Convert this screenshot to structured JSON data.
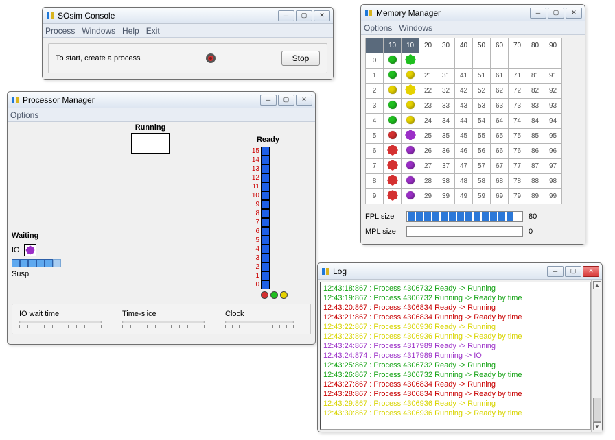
{
  "console": {
    "title": "SOsim Console",
    "menu": [
      "Process",
      "Windows",
      "Help",
      "Exit"
    ],
    "hint": "To start, create a process",
    "stop_label": "Stop"
  },
  "processor": {
    "title": "Processor Manager",
    "menu": [
      "Options"
    ],
    "running_label": "Running",
    "ready_label": "Ready",
    "ready_levels": [
      "15",
      "14",
      "13",
      "12",
      "11",
      "10",
      "9",
      "8",
      "7",
      "6",
      "5",
      "4",
      "3",
      "2",
      "1",
      "0"
    ],
    "waiting_label": "Waiting",
    "io_label": "IO",
    "susp_label": "Susp",
    "io_wait_label": "IO wait time",
    "timeslice_label": "Time-slice",
    "clock_label": "Clock"
  },
  "memory": {
    "title": "Memory Manager",
    "menu": [
      "Options",
      "Windows"
    ],
    "headers": [
      "",
      "10",
      "10",
      "20",
      "30",
      "40",
      "50",
      "60",
      "70",
      "80",
      "90"
    ],
    "rows": [
      {
        "label": "0",
        "dots": [
          {
            "type": "dot",
            "color": "#1fbf1f"
          },
          {
            "type": "burst",
            "cls": "burst-green"
          }
        ]
      },
      {
        "label": "1",
        "dots": [
          {
            "type": "dot",
            "color": "#1fbf1f"
          },
          {
            "type": "dot",
            "color": "#e6d200"
          }
        ],
        "cells": [
          "21",
          "31",
          "41",
          "51",
          "61",
          "71",
          "81",
          "91"
        ]
      },
      {
        "label": "2",
        "dots": [
          {
            "type": "dot",
            "color": "#e6d200"
          },
          {
            "type": "burst",
            "cls": "burst-yellow"
          }
        ],
        "cells": [
          "22",
          "32",
          "42",
          "52",
          "62",
          "72",
          "82",
          "92"
        ]
      },
      {
        "label": "3",
        "dots": [
          {
            "type": "dot",
            "color": "#1fbf1f"
          },
          {
            "type": "dot",
            "color": "#e6d200"
          }
        ],
        "cells": [
          "23",
          "33",
          "43",
          "53",
          "63",
          "73",
          "83",
          "93"
        ]
      },
      {
        "label": "4",
        "dots": [
          {
            "type": "dot",
            "color": "#1fbf1f"
          },
          {
            "type": "dot",
            "color": "#e6d200"
          }
        ],
        "cells": [
          "24",
          "34",
          "44",
          "54",
          "64",
          "74",
          "84",
          "94"
        ]
      },
      {
        "label": "5",
        "dots": [
          {
            "type": "dot",
            "color": "#d43030"
          },
          {
            "type": "burst",
            "cls": "burst-purple"
          }
        ],
        "cells": [
          "25",
          "35",
          "45",
          "55",
          "65",
          "75",
          "85",
          "95"
        ]
      },
      {
        "label": "6",
        "dots": [
          {
            "type": "burst",
            "cls": "burst-red"
          },
          {
            "type": "dot",
            "color": "#9b2fc7"
          }
        ],
        "cells": [
          "26",
          "36",
          "46",
          "56",
          "66",
          "76",
          "86",
          "96"
        ]
      },
      {
        "label": "7",
        "dots": [
          {
            "type": "burst",
            "cls": "burst-red"
          },
          {
            "type": "dot",
            "color": "#9b2fc7"
          }
        ],
        "cells": [
          "27",
          "37",
          "47",
          "57",
          "67",
          "77",
          "87",
          "97"
        ]
      },
      {
        "label": "8",
        "dots": [
          {
            "type": "burst",
            "cls": "burst-red"
          },
          {
            "type": "dot",
            "color": "#9b2fc7"
          }
        ],
        "cells": [
          "28",
          "38",
          "48",
          "58",
          "68",
          "78",
          "88",
          "98"
        ]
      },
      {
        "label": "9",
        "dots": [
          {
            "type": "burst",
            "cls": "burst-red"
          },
          {
            "type": "dot",
            "color": "#9b2fc7"
          }
        ],
        "cells": [
          "29",
          "39",
          "49",
          "59",
          "69",
          "79",
          "89",
          "99"
        ]
      }
    ],
    "fpl_label": "FPL size",
    "fpl_value": "80",
    "mpl_label": "MPL size",
    "mpl_value": "0"
  },
  "log": {
    "title": "Log",
    "lines": [
      {
        "color": "#16a316",
        "text": "12:43:18:867 : Process 4306732 Ready -> Running"
      },
      {
        "color": "#16a316",
        "text": "12:43:19:867 : Process 4306732 Running -> Ready by time"
      },
      {
        "color": "#c80000",
        "text": "12:43:20:867 : Process 4306834 Ready -> Running"
      },
      {
        "color": "#c80000",
        "text": "12:43:21:867 : Process 4306834 Running -> Ready by time"
      },
      {
        "color": "#d8d400",
        "text": "12:43:22:867 : Process 4306936 Ready -> Running"
      },
      {
        "color": "#d8d400",
        "text": "12:43:23:867 : Process 4306936 Running -> Ready by time"
      },
      {
        "color": "#9b2fc7",
        "text": "12:43:24:867 : Process 4317989 Ready -> Running"
      },
      {
        "color": "#9b2fc7",
        "text": "12:43:24:874 : Process 4317989 Running -> IO"
      },
      {
        "color": "#16a316",
        "text": "12:43:25:867 : Process 4306732 Ready -> Running"
      },
      {
        "color": "#16a316",
        "text": "12:43:26:867 : Process 4306732 Running -> Ready by time"
      },
      {
        "color": "#c80000",
        "text": "12:43:27:867 : Process 4306834 Ready -> Running"
      },
      {
        "color": "#c80000",
        "text": "12:43:28:867 : Process 4306834 Running -> Ready by time"
      },
      {
        "color": "#d8d400",
        "text": "12:43:29:867 : Process 4306936 Ready -> Running"
      },
      {
        "color": "#d8d400",
        "text": "12:43:30:867 : Process 4306936 Running -> Ready by time"
      }
    ]
  }
}
